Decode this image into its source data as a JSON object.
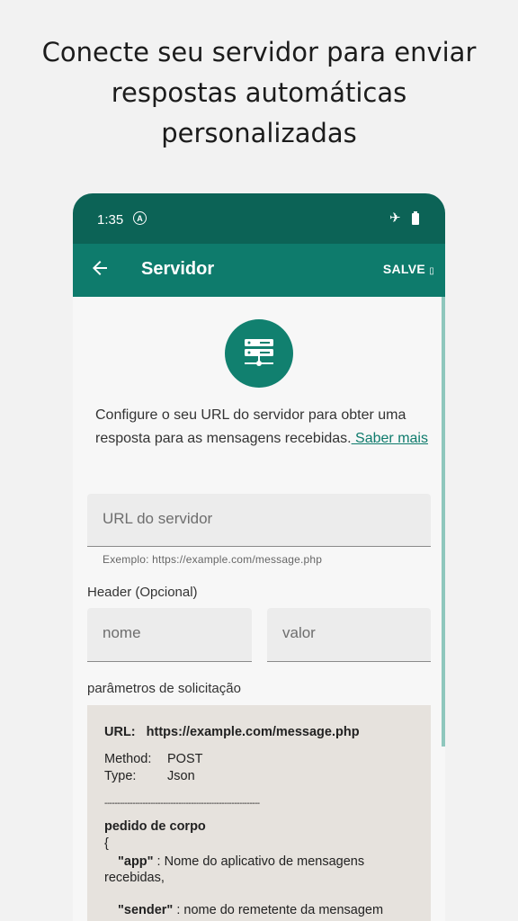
{
  "headline": {
    "line1": "Conecte seu servidor para enviar",
    "line2": "respostas automáticas",
    "line3": "personalizadas"
  },
  "status_bar": {
    "time": "1:35",
    "auto_icon_letter": "A"
  },
  "app_bar": {
    "title": "Servidor",
    "save_label": "SALVE",
    "save_glyph": "▯"
  },
  "description": {
    "text": "Configure o seu URL do servidor para obter uma resposta para as mensagens recebidas.",
    "link": " Saber mais"
  },
  "form": {
    "url_placeholder": "URL do servidor",
    "url_helper": "Exemplo: https://example.com/message.php",
    "header_label": "Header (Opcional)",
    "name_placeholder": "nome",
    "value_placeholder": "valor",
    "params_label": "parâmetros de solicitação"
  },
  "params": {
    "url_key": "URL:",
    "url_value": "https://example.com/message.php",
    "method_key": "Method:",
    "method_value": "POST",
    "type_key": "Type:",
    "type_value": "Json",
    "divider": "-------------------------------------------------------------",
    "body_title": "pedido de corpo",
    "open_brace": "{",
    "app_key": "\"app\"",
    "app_desc": " : Nome do aplicativo de mensagens recebidas,",
    "sender_key": "\"sender\"",
    "sender_desc": " : nome do remetente da mensagem"
  },
  "colors": {
    "status_bar": "#0c6356",
    "app_bar": "#0e7b6c",
    "accent": "#11806f"
  }
}
